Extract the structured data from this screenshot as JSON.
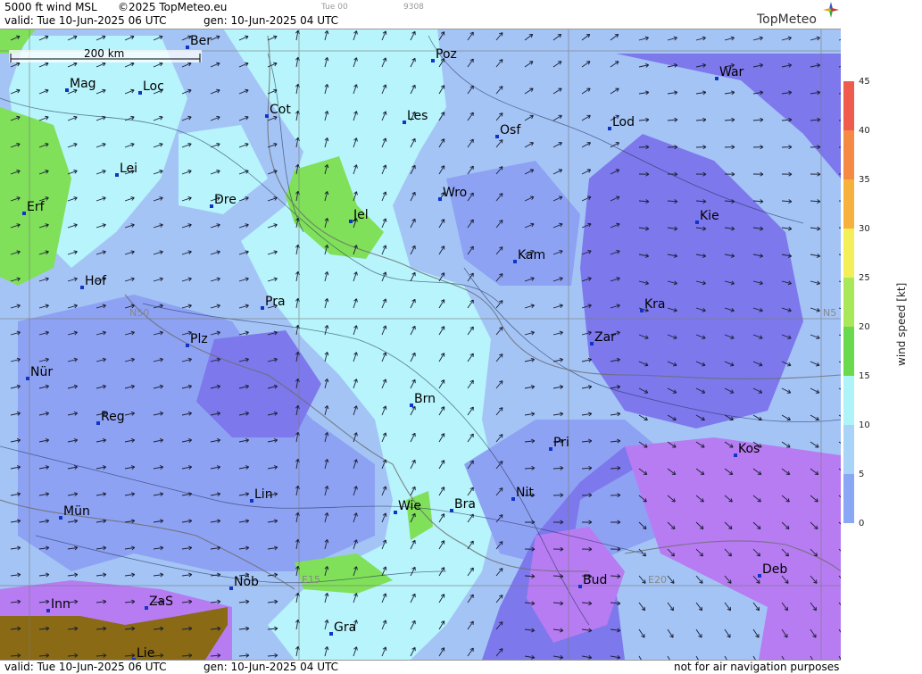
{
  "header": {
    "product": "5000 ft wind MSL",
    "copyright": "©2025 TopMeteo.eu",
    "valid": "valid:  Tue  10-Jun-2025  06 UTC",
    "gen": "gen: 10-Jun-2025 04 UTC",
    "tue00": "Tue 00",
    "code": "9308"
  },
  "footer": {
    "valid": "valid:  Tue  10-Jun-2025  06 UTC",
    "gen": "gen: 10-Jun-2025 04 UTC",
    "disclaimer": "not for air navigation purposes"
  },
  "logo": {
    "text": "TopMeteo"
  },
  "scale_bar": {
    "label": "200 km"
  },
  "grid_labels": {
    "n50": "N50",
    "n50_right": "N5",
    "e15": "E15",
    "e20": "E20"
  },
  "cities": [
    {
      "code": "Ber"
    },
    {
      "code": "Poz"
    },
    {
      "code": "Mag"
    },
    {
      "code": "Loc"
    },
    {
      "code": "War"
    },
    {
      "code": "Cot"
    },
    {
      "code": "Les"
    },
    {
      "code": "Osf"
    },
    {
      "code": "Lod"
    },
    {
      "code": "Lei"
    },
    {
      "code": "Erf"
    },
    {
      "code": "Dre"
    },
    {
      "code": "Wro"
    },
    {
      "code": "Jel"
    },
    {
      "code": "Kie"
    },
    {
      "code": "Kam"
    },
    {
      "code": "Hof"
    },
    {
      "code": "Pra"
    },
    {
      "code": "Kra"
    },
    {
      "code": "Plz"
    },
    {
      "code": "Zar"
    },
    {
      "code": "Nür"
    },
    {
      "code": "Brn"
    },
    {
      "code": "Reg"
    },
    {
      "code": "Pri"
    },
    {
      "code": "Kos"
    },
    {
      "code": "Lin"
    },
    {
      "code": "Nit"
    },
    {
      "code": "Wie"
    },
    {
      "code": "Bra"
    },
    {
      "code": "Mün"
    },
    {
      "code": "Deb"
    },
    {
      "code": "Nöb"
    },
    {
      "code": "Bud"
    },
    {
      "code": "Inn"
    },
    {
      "code": "ZaS"
    },
    {
      "code": "Gra"
    },
    {
      "code": "Lie"
    }
  ],
  "legend": {
    "title": "wind speed [kt]",
    "ticks": [
      "45",
      "40",
      "35",
      "30",
      "25",
      "20",
      "15",
      "10",
      "5",
      "0"
    ],
    "colors": [
      "#ef5b4d",
      "#f58a45",
      "#f6b23d",
      "#f2ef58",
      "#a8e85a",
      "#6bd94e",
      "#aef3f8",
      "#a9d3f7",
      "#8aa7f5",
      "#7a72ef",
      "#c586f5"
    ]
  },
  "colors": {
    "lightcyan": "#b7f4fb",
    "lightblue": "#a4c4f6",
    "blue": "#8ea2f3",
    "violet": "#7d78ec",
    "purple": "#b77cf2",
    "green": "#80e05a",
    "terrain": "#8a6a14"
  }
}
